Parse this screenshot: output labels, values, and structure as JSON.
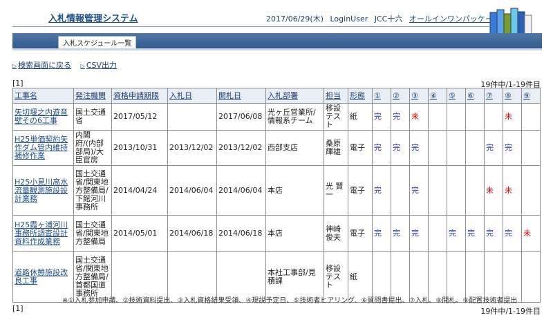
{
  "header": {
    "title": "入札情報管理システム",
    "date": "2017/06/29(木)",
    "user": "LoginUser",
    "company": "JCC十六",
    "package_link": "オールインワンパッケージ"
  },
  "tabs": [
    {
      "label": "入札スケジュール一覧"
    }
  ],
  "actions": {
    "back": "検索画面に戻る",
    "csv": "CSV出力"
  },
  "pager": {
    "page": "[1]",
    "count": "19件中/1-19件目"
  },
  "table": {
    "headers": [
      "工事名",
      "発注機関",
      "資格申請期限",
      "入札日",
      "開札日",
      "入札部署",
      "担当",
      "形態",
      "①",
      "②",
      "③",
      "④",
      "⑤",
      "⑥",
      "⑦",
      "⑧",
      "⑨"
    ],
    "rows": [
      {
        "name": "矢切堰之内遊音壁その6工事",
        "agency": "国土交通省",
        "deadline": "2017/05/12",
        "bid_date": "",
        "open_date": "2017/06/08",
        "dept": "光ヶ丘営業所/情報系チーム",
        "person": "移設テスト",
        "form": "紙",
        "marks": [
          "完",
          "完",
          "未",
          "",
          "",
          "",
          "",
          "未",
          ""
        ]
      },
      {
        "name": "H25単価契約矢作ダム管内維持補修作業",
        "agency": "内閣府/(内部部局)/大臣官房",
        "deadline": "2013/10/31",
        "bid_date": "2013/12/02",
        "open_date": "2013/12/02",
        "dept": "西部支店",
        "person": "桑原 輝雄",
        "form": "電子",
        "marks": [
          "完",
          "完",
          "完",
          "",
          "",
          "",
          "完",
          "完",
          ""
        ]
      },
      {
        "name": "H25小見川高水流量観測施設設計業務",
        "agency": "国土交通省/関東地方整備局/下館河川事務所",
        "deadline": "2014/04/24",
        "bid_date": "2014/06/04",
        "open_date": "2014/06/04",
        "dept": "本店",
        "person": "光 賢一",
        "form": "電子",
        "marks": [
          "完",
          "",
          "完",
          "",
          "",
          "",
          "未",
          "未",
          ""
        ]
      },
      {
        "name": "H25霞ヶ浦河川事務所調査設計資料作成業務",
        "agency": "国土交通省/関東地方整備局",
        "deadline": "2014/05/01",
        "bid_date": "2014/06/18",
        "open_date": "2014/06/18",
        "dept": "本店",
        "person": "神崎 俊夫",
        "form": "電子",
        "marks": [
          "完",
          "完",
          "完",
          "",
          "完",
          "完",
          "完",
          "完",
          "未"
        ]
      },
      {
        "name": "道路休憩施設改良工事",
        "agency": "国土交通省/関東地方整備局/首都国道事務所",
        "deadline": "",
        "bid_date": "",
        "open_date": "",
        "dept": "本社工事部/見積課",
        "person": "移設テスト",
        "form": "紙",
        "marks": [
          "",
          "",
          "",
          "",
          "",
          "",
          "",
          "",
          ""
        ]
      }
    ]
  },
  "footnote": "※①入札参加申請、②技術資料提出、③入札資格結果受領、④現説予定日、⑤技術者ヒアリング、⑥質問書提出、⑦入札、⑧開札、⑨配置技術者提出",
  "colors": {
    "done": "#1f2fd0",
    "todo": "#e00000",
    "header_bar": "#335a8c"
  }
}
